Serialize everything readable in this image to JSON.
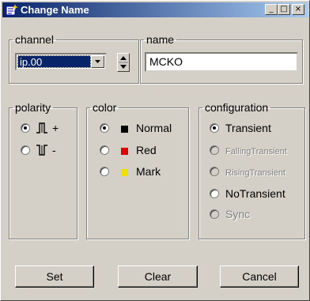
{
  "window": {
    "title": "Change Name",
    "minimize_label": "_",
    "maximize_label": "□",
    "close_label": "×"
  },
  "channel_group": {
    "legend": "channel",
    "selected_value": "ip.00"
  },
  "name_group": {
    "legend": "name",
    "value": "MCKO"
  },
  "polarity_group": {
    "legend": "polarity",
    "options": [
      {
        "label": "+",
        "checked": true
      },
      {
        "label": "-",
        "checked": false
      }
    ]
  },
  "color_group": {
    "legend": "color",
    "options": [
      {
        "label": "Normal",
        "checked": true,
        "swatch": "#000000"
      },
      {
        "label": "Red",
        "checked": false,
        "swatch": "#e00000"
      },
      {
        "label": "Mark",
        "checked": false,
        "swatch": "#f0e000"
      }
    ]
  },
  "configuration_group": {
    "legend": "configuration",
    "options": [
      {
        "label": "Transient",
        "checked": true,
        "enabled": true
      },
      {
        "label": "FallingTransient",
        "checked": false,
        "enabled": false
      },
      {
        "label": "RisingTransient",
        "checked": false,
        "enabled": false
      },
      {
        "label": "NoTransient",
        "checked": false,
        "enabled": true
      },
      {
        "label": "Sync",
        "checked": false,
        "enabled": false
      }
    ]
  },
  "buttons": {
    "set": "Set",
    "clear": "Clear",
    "cancel": "Cancel"
  }
}
